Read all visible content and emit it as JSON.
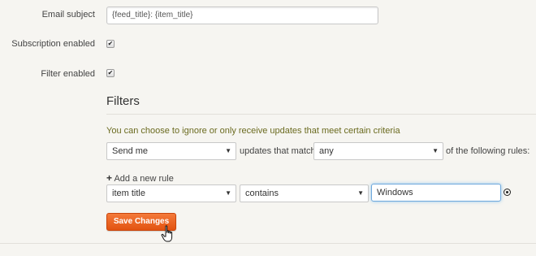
{
  "form": {
    "email_subject_label": "Email subject",
    "email_subject_value": "{feed_title}: {item_title}",
    "subscription_enabled_label": "Subscription enabled",
    "subscription_enabled_checked": true,
    "filter_enabled_label": "Filter enabled",
    "filter_enabled_checked": true,
    "check_mark": "✔"
  },
  "filters": {
    "heading": "Filters",
    "description": "You can choose to ignore or only receive updates that meet certain criteria",
    "action_select": "Send me",
    "match_text": "updates that match",
    "match_select": "any",
    "rules_text": "of the following rules:",
    "add_rule_icon": "+",
    "add_rule_label": "Add a new rule",
    "rule": {
      "field_select": "item title",
      "operator_select": "contains",
      "value": "Windows"
    },
    "caret": "▼"
  },
  "actions": {
    "save_label": "Save Changes"
  },
  "icons": {
    "plus": "plus-icon",
    "remove": "remove-rule-icon",
    "cursor": "hand-cursor-icon"
  },
  "colors": {
    "background": "#f6f5f1",
    "save_button": "#e8601e",
    "description_text": "#6b6b20",
    "focus_border": "#6fa8dc"
  }
}
